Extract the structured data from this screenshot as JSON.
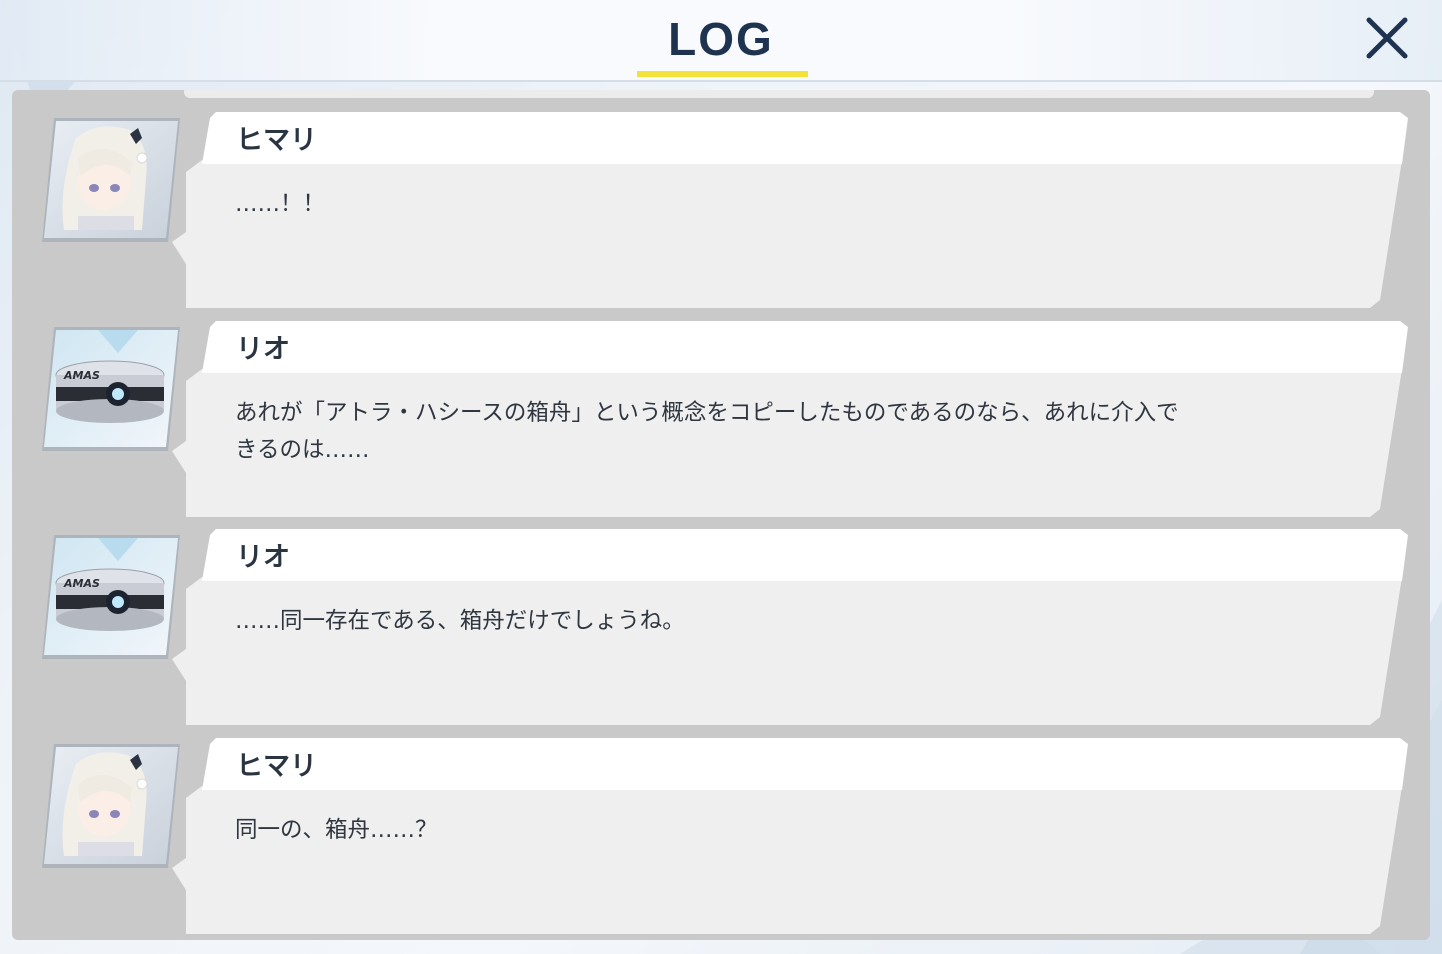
{
  "header": {
    "title": "LOG",
    "close_icon": "close-icon",
    "accent_color": "#f4e13a"
  },
  "entries": [
    {
      "speaker": "ヒマリ",
      "avatar": "himari-portrait",
      "text": "……！！"
    },
    {
      "speaker": "リオ",
      "avatar": "amas-drone-portrait",
      "avatar_label": "AMAS",
      "text": "あれが「アトラ・ハシースの箱舟」という概念をコピーしたものであるのなら、あれに介入で\nきるのは……"
    },
    {
      "speaker": "リオ",
      "avatar": "amas-drone-portrait",
      "avatar_label": "AMAS",
      "text": "……同一存在である、箱舟だけでしょうね。"
    },
    {
      "speaker": "ヒマリ",
      "avatar": "himari-portrait",
      "text": "同一の、箱舟……？"
    }
  ]
}
